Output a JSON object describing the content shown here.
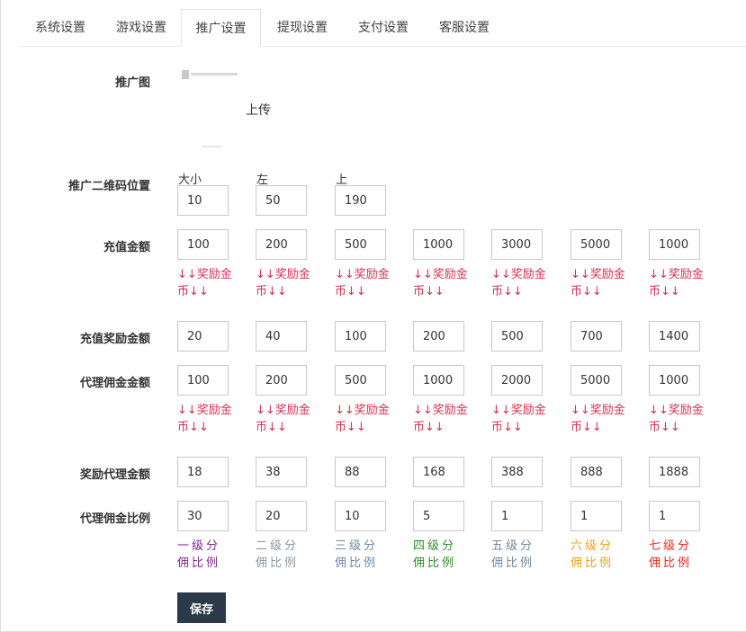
{
  "tabs": [
    "系统设置",
    "游戏设置",
    "推广设置",
    "提现设置",
    "支付设置",
    "客服设置"
  ],
  "active_tab_index": 2,
  "promo_image": {
    "label": "推广图",
    "upload_label": "上传"
  },
  "qr_position": {
    "label": "推广二维码位置",
    "fields": [
      {
        "label": "大小",
        "value": "10"
      },
      {
        "label": "左",
        "value": "50"
      },
      {
        "label": "上",
        "value": "190"
      }
    ]
  },
  "recharge_amount": {
    "label": "充值金额",
    "values": [
      "100",
      "200",
      "500",
      "1000",
      "3000",
      "5000",
      "1000"
    ],
    "hint": "↓↓奖励金币↓↓"
  },
  "recharge_reward": {
    "label": "充值奖励金额",
    "values": [
      "20",
      "40",
      "100",
      "200",
      "500",
      "700",
      "1400"
    ]
  },
  "agent_commission_amount": {
    "label": "代理佣金金额",
    "values": [
      "100",
      "200",
      "500",
      "1000",
      "2000",
      "5000",
      "1000"
    ],
    "hint": "↓↓奖励金币↓↓"
  },
  "agent_reward": {
    "label": "奖励代理金额",
    "values": [
      "18",
      "38",
      "88",
      "168",
      "388",
      "888",
      "1888"
    ]
  },
  "commission_ratio": {
    "label": "代理佣金比例",
    "values": [
      "30",
      "20",
      "10",
      "5",
      "1",
      "1",
      "1"
    ],
    "levels": [
      {
        "text": "一级分佣比例",
        "color": "#7a2a8a"
      },
      {
        "text": "二级分佣比例",
        "color": "#8a96a2"
      },
      {
        "text": "三级分佣比例",
        "color": "#6f8aa0"
      },
      {
        "text": "四级分佣比例",
        "color": "#2e8a2e"
      },
      {
        "text": "五级分佣比例",
        "color": "#6f8aa0"
      },
      {
        "text": "六级分佣比例",
        "color": "#f0a020"
      },
      {
        "text": "七级分佣比例",
        "color": "#e02a1a"
      }
    ]
  },
  "save_label": "保存"
}
